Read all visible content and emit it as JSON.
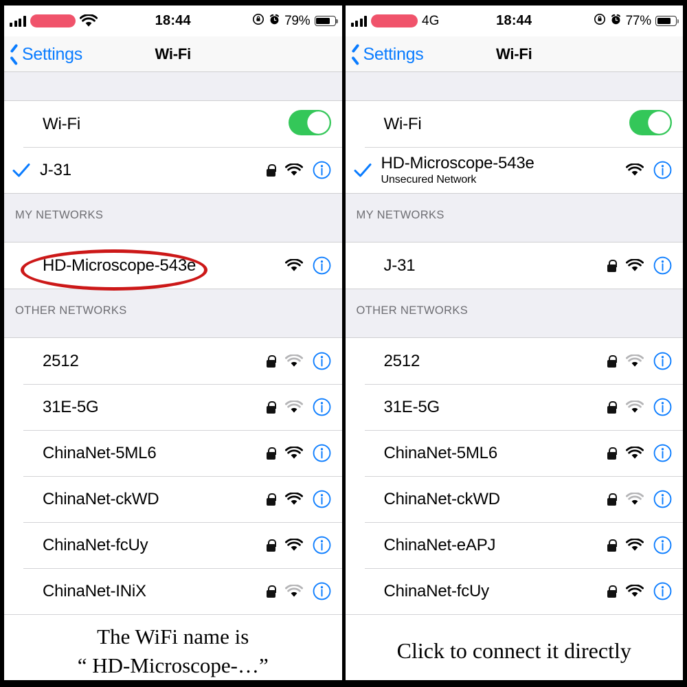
{
  "panels": [
    {
      "id": "left",
      "statusbar": {
        "signal_icon": "cellular-bars-icon",
        "carrier": "",
        "carrier_redacted": true,
        "network_type": "",
        "wifi_icon": "wifi-icon",
        "time": "18:44",
        "rotation_lock_icon": "rotation-lock-icon",
        "alarm_icon": "alarm-clock-icon",
        "battery_percent": "79%",
        "battery_level": 79
      },
      "nav": {
        "back_label": "Settings",
        "back_icon": "chevron-left-icon",
        "title": "Wi-Fi"
      },
      "toggle_row": {
        "label": "Wi-Fi",
        "toggle_on": true,
        "toggle_color": "#34c759"
      },
      "connected": {
        "name": "J-31",
        "subtitle": "",
        "checked": true,
        "locked": true,
        "signal": 3
      },
      "sections": [
        {
          "header": "MY NETWORKS",
          "rows": [
            {
              "name": "HD-Microscope-543e",
              "locked": false,
              "signal": 3,
              "highlight": true
            }
          ]
        },
        {
          "header": "OTHER NETWORKS",
          "rows": [
            {
              "name": "2512",
              "locked": true,
              "signal": 2
            },
            {
              "name": "31E-5G",
              "locked": true,
              "signal": 2
            },
            {
              "name": "ChinaNet-5ML6",
              "locked": true,
              "signal": 3
            },
            {
              "name": "ChinaNet-ckWD",
              "locked": true,
              "signal": 3
            },
            {
              "name": "ChinaNet-fcUy",
              "locked": true,
              "signal": 3
            },
            {
              "name": "ChinaNet-INiX",
              "locked": true,
              "signal": 2
            }
          ]
        }
      ],
      "caption_lines": [
        "The WiFi name is",
        "“ HD-Microscope-…”"
      ]
    },
    {
      "id": "right",
      "statusbar": {
        "signal_icon": "cellular-bars-icon",
        "carrier": "",
        "carrier_redacted": true,
        "network_type": "4G",
        "wifi_icon": "",
        "time": "18:44",
        "rotation_lock_icon": "rotation-lock-icon",
        "alarm_icon": "alarm-clock-icon",
        "battery_percent": "77%",
        "battery_level": 77
      },
      "nav": {
        "back_label": "Settings",
        "back_icon": "chevron-left-icon",
        "title": "Wi-Fi"
      },
      "toggle_row": {
        "label": "Wi-Fi",
        "toggle_on": true,
        "toggle_color": "#34c759"
      },
      "connected": {
        "name": "HD-Microscope-543e",
        "subtitle": "Unsecured Network",
        "checked": true,
        "locked": false,
        "signal": 3
      },
      "sections": [
        {
          "header": "MY NETWORKS",
          "rows": [
            {
              "name": "J-31",
              "locked": true,
              "signal": 3,
              "highlight": false
            }
          ]
        },
        {
          "header": "OTHER NETWORKS",
          "rows": [
            {
              "name": "2512",
              "locked": true,
              "signal": 2
            },
            {
              "name": "31E-5G",
              "locked": true,
              "signal": 2
            },
            {
              "name": "ChinaNet-5ML6",
              "locked": true,
              "signal": 3
            },
            {
              "name": "ChinaNet-ckWD",
              "locked": true,
              "signal": 2
            },
            {
              "name": "ChinaNet-eAPJ",
              "locked": true,
              "signal": 3
            },
            {
              "name": "ChinaNet-fcUy",
              "locked": true,
              "signal": 3
            }
          ]
        }
      ],
      "caption_lines": [
        "Click to connect it directly"
      ]
    }
  ],
  "annotation": {
    "type": "red-oval",
    "color": "#cc1818",
    "target_text": "HD-Microscope-543e",
    "panel": "left"
  },
  "colors": {
    "accent_blue": "#0a7cff",
    "toggle_green": "#34c759",
    "group_bg": "#efeff4",
    "annotation_red": "#cc1818",
    "redaction_pink": "#f0536b"
  }
}
